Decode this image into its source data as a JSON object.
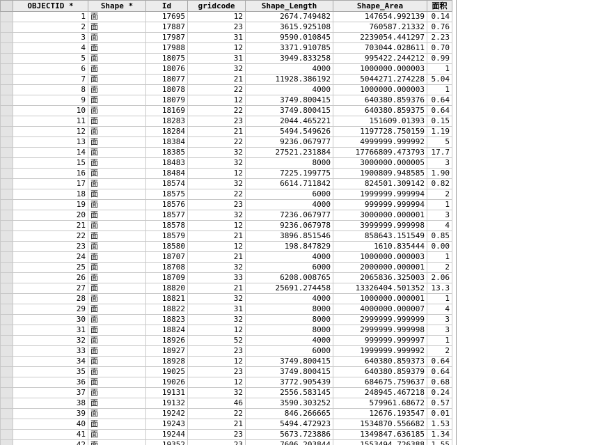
{
  "columns": [
    "",
    "OBJECTID *",
    "Shape *",
    "Id",
    "gridcode",
    "Shape_Length",
    "Shape_Area",
    "面积"
  ],
  "rows": [
    [
      "1",
      "面",
      "17695",
      "12",
      "2674.749482",
      "147654.992139",
      "0.14"
    ],
    [
      "2",
      "面",
      "17887",
      "23",
      "3615.925108",
      "760587.21332",
      "0.76"
    ],
    [
      "3",
      "面",
      "17987",
      "31",
      "9590.010845",
      "2239054.441297",
      "2.23"
    ],
    [
      "4",
      "面",
      "17988",
      "12",
      "3371.910785",
      "703044.028611",
      "0.70"
    ],
    [
      "5",
      "面",
      "18075",
      "31",
      "3949.833258",
      "995422.244212",
      "0.99"
    ],
    [
      "6",
      "面",
      "18076",
      "32",
      "4000",
      "1000000.000003",
      "1"
    ],
    [
      "7",
      "面",
      "18077",
      "21",
      "11928.386192",
      "5044271.274228",
      "5.04"
    ],
    [
      "8",
      "面",
      "18078",
      "22",
      "4000",
      "1000000.000003",
      "1"
    ],
    [
      "9",
      "面",
      "18079",
      "12",
      "3749.800415",
      "640380.859376",
      "0.64"
    ],
    [
      "10",
      "面",
      "18169",
      "22",
      "3749.800415",
      "640380.859375",
      "0.64"
    ],
    [
      "11",
      "面",
      "18283",
      "23",
      "2044.465221",
      "151609.01393",
      "0.15"
    ],
    [
      "12",
      "面",
      "18284",
      "21",
      "5494.549626",
      "1197728.750159",
      "1.19"
    ],
    [
      "13",
      "面",
      "18384",
      "22",
      "9236.067977",
      "4999999.999992",
      "5"
    ],
    [
      "14",
      "面",
      "18385",
      "32",
      "27521.231884",
      "17766809.473793",
      "17.7"
    ],
    [
      "15",
      "面",
      "18483",
      "32",
      "8000",
      "3000000.000005",
      "3"
    ],
    [
      "16",
      "面",
      "18484",
      "12",
      "7225.199775",
      "1900809.948585",
      "1.90"
    ],
    [
      "17",
      "面",
      "18574",
      "32",
      "6614.711842",
      "824501.309142",
      "0.82"
    ],
    [
      "18",
      "面",
      "18575",
      "22",
      "6000",
      "1999999.999994",
      "2"
    ],
    [
      "19",
      "面",
      "18576",
      "23",
      "4000",
      "999999.999994",
      "1"
    ],
    [
      "20",
      "面",
      "18577",
      "32",
      "7236.067977",
      "3000000.000001",
      "3"
    ],
    [
      "21",
      "面",
      "18578",
      "12",
      "9236.067978",
      "3999999.999998",
      "4"
    ],
    [
      "22",
      "面",
      "18579",
      "21",
      "3896.851546",
      "858643.151549",
      "0.85"
    ],
    [
      "23",
      "面",
      "18580",
      "12",
      "198.847829",
      "1610.835444",
      "0.00"
    ],
    [
      "24",
      "面",
      "18707",
      "21",
      "4000",
      "1000000.000003",
      "1"
    ],
    [
      "25",
      "面",
      "18708",
      "32",
      "6000",
      "2000000.000001",
      "2"
    ],
    [
      "26",
      "面",
      "18709",
      "33",
      "6208.008765",
      "2065836.325003",
      "2.06"
    ],
    [
      "27",
      "面",
      "18820",
      "21",
      "25691.274458",
      "13326404.501352",
      "13.3"
    ],
    [
      "28",
      "面",
      "18821",
      "32",
      "4000",
      "1000000.000001",
      "1"
    ],
    [
      "29",
      "面",
      "18822",
      "31",
      "8000",
      "4000000.000007",
      "4"
    ],
    [
      "30",
      "面",
      "18823",
      "32",
      "8000",
      "2999999.999999",
      "3"
    ],
    [
      "31",
      "面",
      "18824",
      "12",
      "8000",
      "2999999.999998",
      "3"
    ],
    [
      "32",
      "面",
      "18926",
      "52",
      "4000",
      "999999.999997",
      "1"
    ],
    [
      "33",
      "面",
      "18927",
      "23",
      "6000",
      "1999999.999992",
      "2"
    ],
    [
      "34",
      "面",
      "18928",
      "12",
      "3749.800415",
      "640380.859373",
      "0.64"
    ],
    [
      "35",
      "面",
      "19025",
      "23",
      "3749.800415",
      "640380.859379",
      "0.64"
    ],
    [
      "36",
      "面",
      "19026",
      "12",
      "3772.905439",
      "684675.759637",
      "0.68"
    ],
    [
      "37",
      "面",
      "19131",
      "32",
      "2556.583145",
      "248945.467218",
      "0.24"
    ],
    [
      "38",
      "面",
      "19132",
      "46",
      "3590.303252",
      "579961.68672",
      "0.57"
    ],
    [
      "39",
      "面",
      "19242",
      "22",
      "846.266665",
      "12676.193547",
      "0.01"
    ],
    [
      "40",
      "面",
      "19243",
      "21",
      "5494.472923",
      "1534870.556682",
      "1.53"
    ],
    [
      "41",
      "面",
      "19244",
      "23",
      "5673.723886",
      "1349847.636185",
      "1.34"
    ],
    [
      "42",
      "面",
      "19352",
      "23",
      "7606.203844",
      "1553494.726388",
      "1.55"
    ]
  ]
}
